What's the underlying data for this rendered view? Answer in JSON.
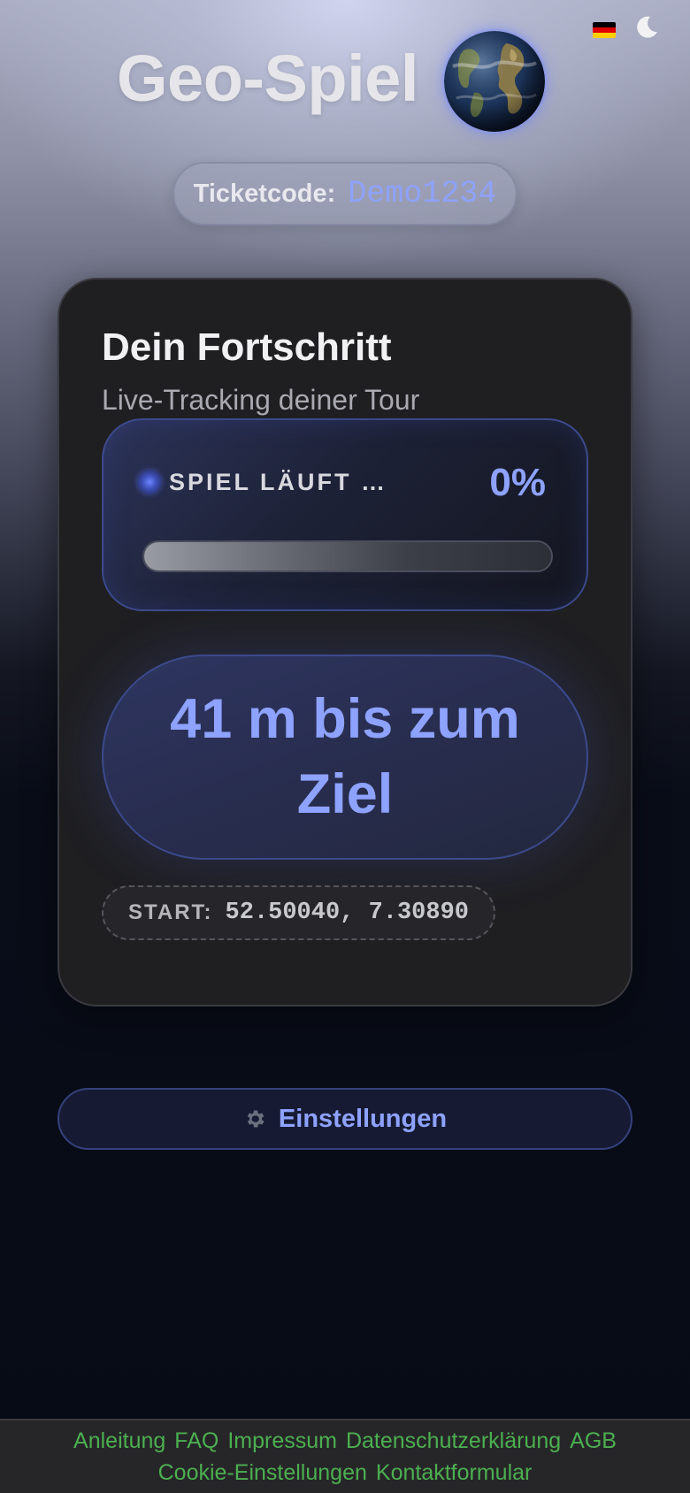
{
  "header": {
    "title": "Geo-Spiel",
    "language_icon": "german-flag-icon",
    "theme_icon": "moon-icon",
    "globe_icon": "earth-globe-icon"
  },
  "ticket": {
    "label": "Ticketcode:",
    "code": "Demo1234"
  },
  "progress_card": {
    "title": "Dein Fortschritt",
    "subtitle": "Live-Tracking deiner Tour",
    "status_text": "SPIEL LÄUFT …",
    "percent_label": "0%",
    "progress_value": 0,
    "distance_text": "41 m bis zum Ziel",
    "start_label": "START:",
    "start_coords": "52.50040, 7.30890"
  },
  "settings": {
    "label": "Einstellungen",
    "icon": "gear-icon"
  },
  "footer": {
    "links": [
      "Anleitung",
      "FAQ",
      "Impressum",
      "Datenschutzerklärung",
      "AGB",
      "Cookie-Einstellungen",
      "Kontaktformular"
    ]
  },
  "colors": {
    "accent": "#8ea2ff",
    "footer_link": "#4caf50",
    "card_background": "#1f1f22"
  }
}
